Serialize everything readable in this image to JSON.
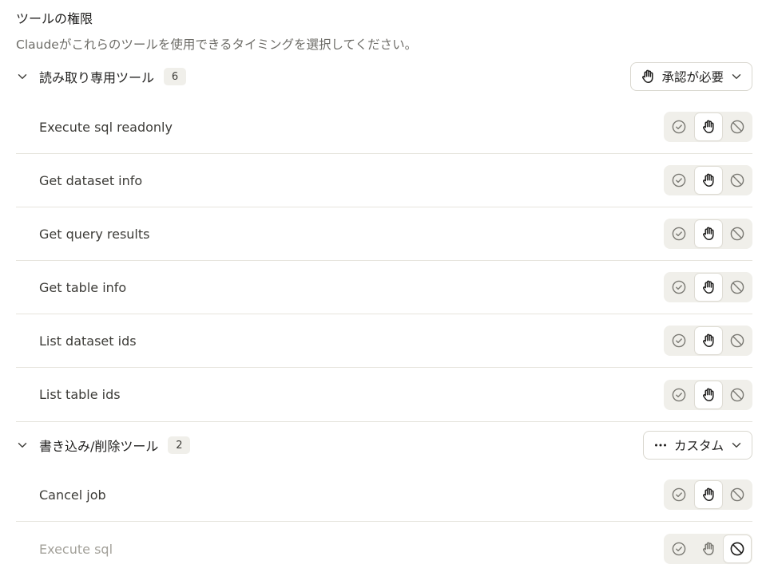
{
  "header": {
    "title": "ツールの権限",
    "subtitle": "Claudeがこれらのツールを使用できるタイミングを選択してください。"
  },
  "groups": [
    {
      "name": "読み取り専用ツール",
      "count": "6",
      "mode_label": "承認が必要",
      "mode_icon": "hand-icon",
      "tools": [
        {
          "name": "Execute sql readonly",
          "permission": "needs-approval"
        },
        {
          "name": "Get dataset info",
          "permission": "needs-approval"
        },
        {
          "name": "Get query results",
          "permission": "needs-approval"
        },
        {
          "name": "Get table info",
          "permission": "needs-approval"
        },
        {
          "name": "List dataset ids",
          "permission": "needs-approval"
        },
        {
          "name": "List table ids",
          "permission": "needs-approval"
        }
      ]
    },
    {
      "name": "書き込み/削除ツール",
      "count": "2",
      "mode_label": "カスタム",
      "mode_icon": "more-dots-icon",
      "tools": [
        {
          "name": "Cancel job",
          "permission": "needs-approval"
        },
        {
          "name": "Execute sql",
          "permission": "blocked"
        }
      ]
    }
  ],
  "colors": {
    "text_primary": "#1f1e1d",
    "text_muted": "#6e6d68",
    "segment_bg": "#f0efea",
    "divider": "#e6e4dd"
  }
}
